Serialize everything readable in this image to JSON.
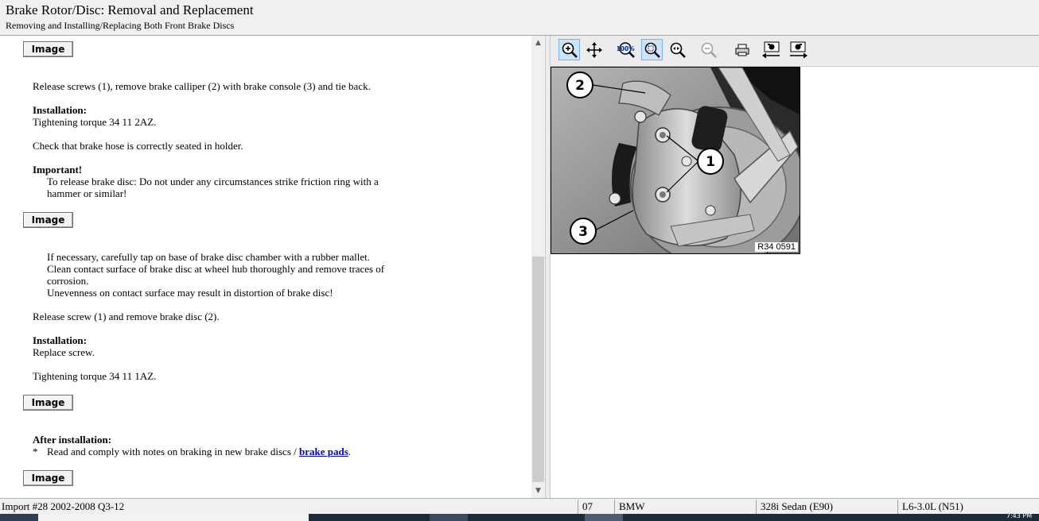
{
  "window": {
    "title": "Brake Rotor/Disc:  Removal and Replacement",
    "subtitle": "Removing and Installing/Replacing Both Front Brake Discs"
  },
  "content": {
    "image_button_label": "Image",
    "p1": "Release screws (1), remove brake calliper (2) with brake console (3) and tie back.",
    "installation_heading": "Installation:",
    "p2": "Tightening torque 34 11 2AZ.",
    "p3": "Check that brake hose is correctly seated in holder.",
    "important_heading": "Important!",
    "important_line1": "To release brake disc: Do not under any circumstances strike friction ring with a",
    "important_line2": "hammer or similar!",
    "note_line1": "If necessary, carefully tap on base of brake disc chamber with a rubber mallet.",
    "note_line2": "Clean contact surface of brake disc at wheel hub thoroughly and remove traces of",
    "note_line3": "corrosion.",
    "note_line4": "Unevenness on contact surface may result in distortion of brake disc!",
    "p4": "Release screw (1) and remove brake disc (2).",
    "installation_heading2": "Installation:",
    "p5": "Replace screw.",
    "p6": "Tightening torque 34 11 1AZ.",
    "after_heading": "After installation:",
    "bullet": "*",
    "after_text": "Read and comply with notes on braking in new brake discs /",
    "after_link": "brake pads",
    "after_period": "."
  },
  "figure": {
    "callout_1": "1",
    "callout_2": "2",
    "callout_3": "3",
    "code": "R34 0591"
  },
  "toolbar": {
    "icons": [
      "zoom-in-icon",
      "pan-icon",
      "zoom-100-icon",
      "zoom-fit-icon",
      "zoom-out-icon",
      "zoom-out-disabled-icon",
      "print-icon",
      "previous-image-icon",
      "next-image-icon"
    ],
    "zoom_100_label": "100%"
  },
  "status": {
    "import": "Import #28 2002-2008 Q3-12",
    "code": "07",
    "make": "BMW",
    "model": "328i Sedan (E90)",
    "engine": "L6-3.0L (N51)"
  },
  "taskbar": {
    "clock": "7:43 PM"
  },
  "colors": {
    "link": "#0000cc",
    "toolbar_active": "#cce4f7"
  }
}
